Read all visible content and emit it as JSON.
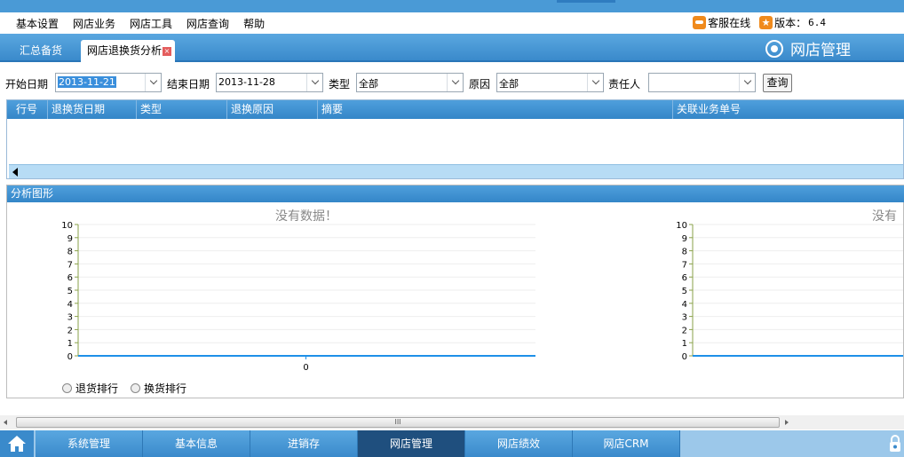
{
  "menu": {
    "items": [
      "基本设置",
      "网店业务",
      "网店工具",
      "网店查询",
      "帮助"
    ]
  },
  "status": {
    "service": "客服在线",
    "version_label": "版本：",
    "version_value": "6.4"
  },
  "tabs": {
    "summary": "汇总备货",
    "active": "网店退换货分析",
    "close_glyph": "×"
  },
  "module_title": "网店管理",
  "filter": {
    "start_label": "开始日期",
    "start_value": "2013-11-21",
    "end_label": "结束日期",
    "end_value": "2013-11-28",
    "type_label": "类型",
    "type_value": "全部",
    "reason_label": "原因",
    "reason_value": "全部",
    "owner_label": "责任人",
    "owner_value": "",
    "query_button": "查询"
  },
  "grid": {
    "columns": [
      "行号",
      "退换货日期",
      "类型",
      "退换原因",
      "摘要",
      "关联业务单号"
    ]
  },
  "panel": {
    "title": "分析图形",
    "radio_return": "退货排行",
    "radio_exchange": "换货排行"
  },
  "chart_data": [
    {
      "type": "bar",
      "title": "没有数据！",
      "categories": [
        "0"
      ],
      "values": [
        0
      ],
      "ylim": [
        0,
        10
      ],
      "yticks": [
        0,
        1,
        2,
        3,
        4,
        5,
        6,
        7,
        8,
        9,
        10
      ],
      "grid": true
    },
    {
      "type": "bar",
      "title": "没有",
      "categories": [],
      "values": [],
      "ylim": [
        0,
        10
      ],
      "yticks": [
        0,
        1,
        2,
        3,
        4,
        5,
        6,
        7,
        8,
        9,
        10
      ],
      "grid": true
    }
  ],
  "scrollbar_grip": "III",
  "taskbar": {
    "items": [
      "系统管理",
      "基本信息",
      "进销存",
      "网店管理",
      "网店绩效",
      "网店CRM"
    ],
    "active_index": 3
  }
}
